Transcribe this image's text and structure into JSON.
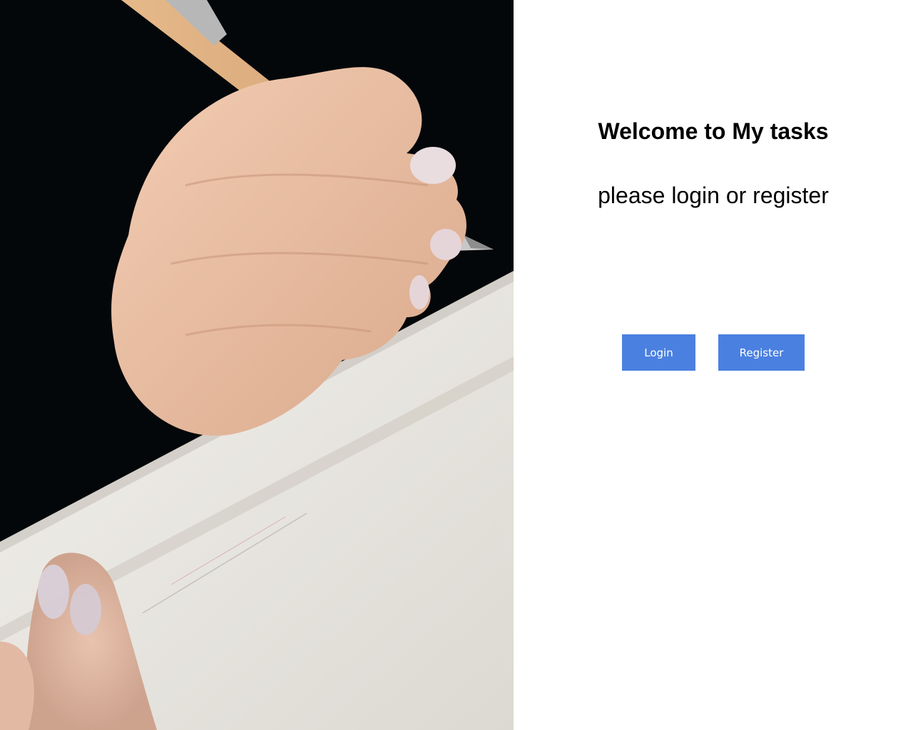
{
  "hero": {
    "image_name": "hand-writing-in-notebook-photo"
  },
  "welcome": {
    "title": "Welcome to My tasks",
    "subtitle": "please login or register"
  },
  "actions": {
    "login_label": "Login",
    "register_label": "Register"
  },
  "colors": {
    "button_bg": "#4a80e0",
    "button_text": "#ffffff",
    "page_bg": "#ffffff",
    "text": "#000000"
  }
}
